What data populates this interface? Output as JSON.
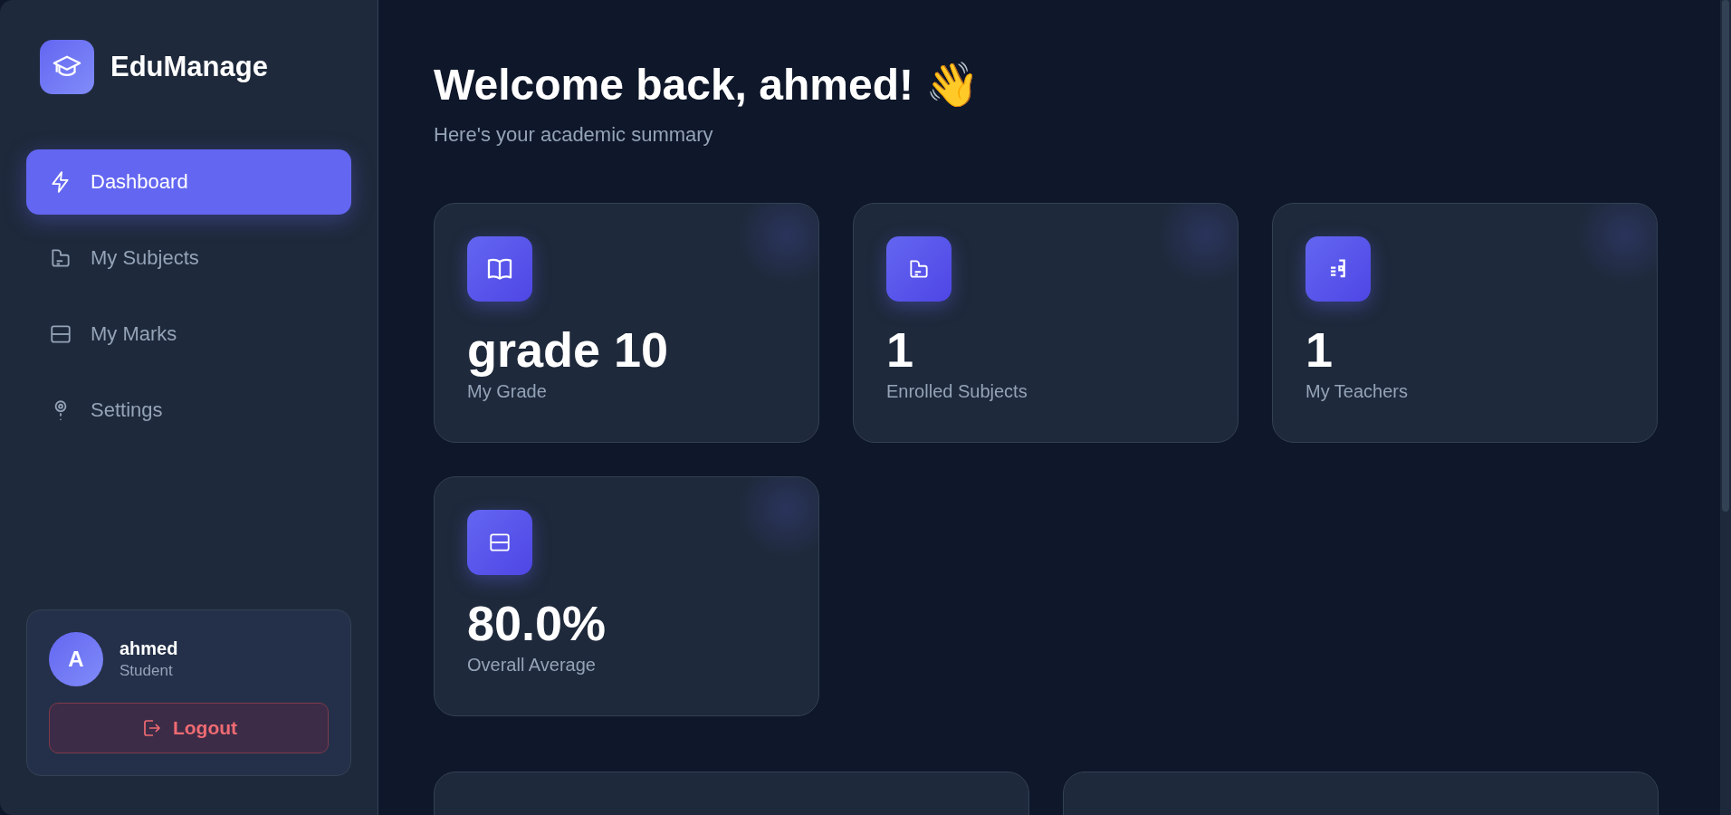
{
  "sidebar": {
    "brand": "EduManage",
    "nav": [
      {
        "label": "Dashboard",
        "selected": true
      },
      {
        "label": "My Subjects",
        "selected": false
      },
      {
        "label": "My Marks",
        "selected": false
      },
      {
        "label": "Settings",
        "selected": false
      }
    ],
    "user": {
      "avatar": "A",
      "name": "ahmed",
      "role": "Student"
    },
    "logout": "Logout"
  },
  "header": {
    "title": "Welcome back, ahmed! 👋",
    "subtitle": "Here's your academic summary"
  },
  "stats": [
    {
      "value": "grade 10",
      "label": "My Grade"
    },
    {
      "value": "1",
      "label": "Enrolled Subjects"
    },
    {
      "value": "1",
      "label": "My Teachers"
    },
    {
      "value": "80.0%",
      "label": "Overall Average"
    }
  ],
  "panels": [
    {
      "kind": "panel"
    },
    {
      "kind": "panel"
    }
  ]
}
